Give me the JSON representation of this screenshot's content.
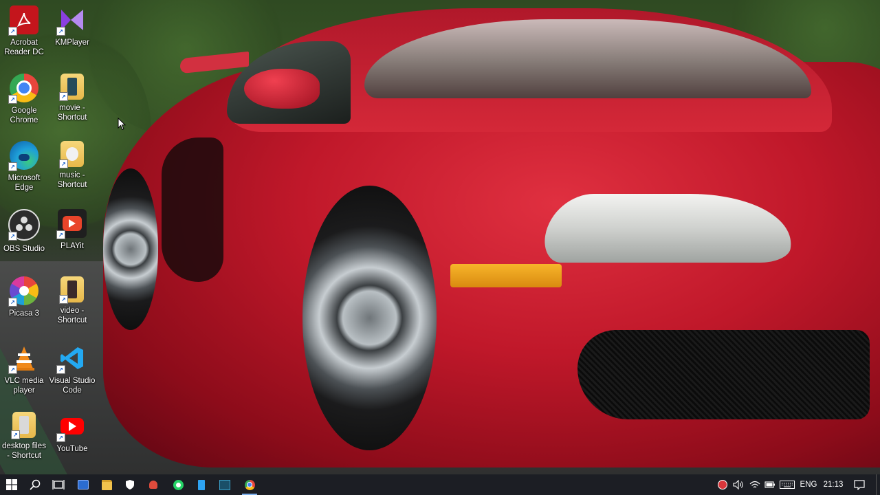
{
  "desktop": {
    "icons": [
      {
        "label": "Acrobat Reader DC",
        "icon": "acrobat-icon",
        "color": "#c4151c"
      },
      {
        "label": "KMPlayer",
        "icon": "kmplayer-icon",
        "color": "#8a3fe0"
      },
      {
        "label": "Google Chrome",
        "icon": "chrome-icon",
        "color": "#e8453c"
      },
      {
        "label": "movie - Shortcut",
        "icon": "folder-icon",
        "color": "#e7b84a"
      },
      {
        "label": "Microsoft Edge",
        "icon": "edge-icon",
        "color": "#1e9fd9"
      },
      {
        "label": "music - Shortcut",
        "icon": "folder-icon",
        "color": "#e7b84a"
      },
      {
        "label": "OBS Studio",
        "icon": "obs-icon",
        "color": "#2c2c2c"
      },
      {
        "label": "PLAYit",
        "icon": "playit-icon",
        "color": "#e9442a"
      },
      {
        "label": "Picasa 3",
        "icon": "picasa-icon",
        "color": "#6db33f"
      },
      {
        "label": "video - Shortcut",
        "icon": "folder-icon",
        "color": "#e7b84a"
      },
      {
        "label": "VLC media player",
        "icon": "vlc-icon",
        "color": "#f08a1c"
      },
      {
        "label": "Visual Studio Code",
        "icon": "vscode-icon",
        "color": "#23a9f2"
      },
      {
        "label": "desktop files - Shortcut",
        "icon": "folder-icon",
        "color": "#e7b84a"
      },
      {
        "label": "YouTube",
        "icon": "youtube-icon",
        "color": "#ff0000"
      }
    ]
  },
  "taskbar": {
    "start_icon": "windows-start-icon",
    "search_icon": "search-icon",
    "task_view_icon": "task-view-icon",
    "pinned": [
      {
        "name": "calculator-app-icon",
        "color": "#2b6cd1"
      },
      {
        "name": "file-explorer-icon",
        "color": "#f3c34d"
      },
      {
        "name": "security-shield-icon",
        "color": "#ffffff"
      },
      {
        "name": "recorder-app-icon",
        "color": "#e04b3c"
      },
      {
        "name": "whatsapp-icon",
        "color": "#25d366"
      },
      {
        "name": "document-app-icon",
        "color": "#2ea3f2"
      },
      {
        "name": "remote-app-icon",
        "color": "#3aa0c9"
      },
      {
        "name": "chrome-taskbar-icon",
        "color": "#e8453c"
      }
    ],
    "tray": {
      "language": "ENG",
      "time": "21:13"
    }
  }
}
